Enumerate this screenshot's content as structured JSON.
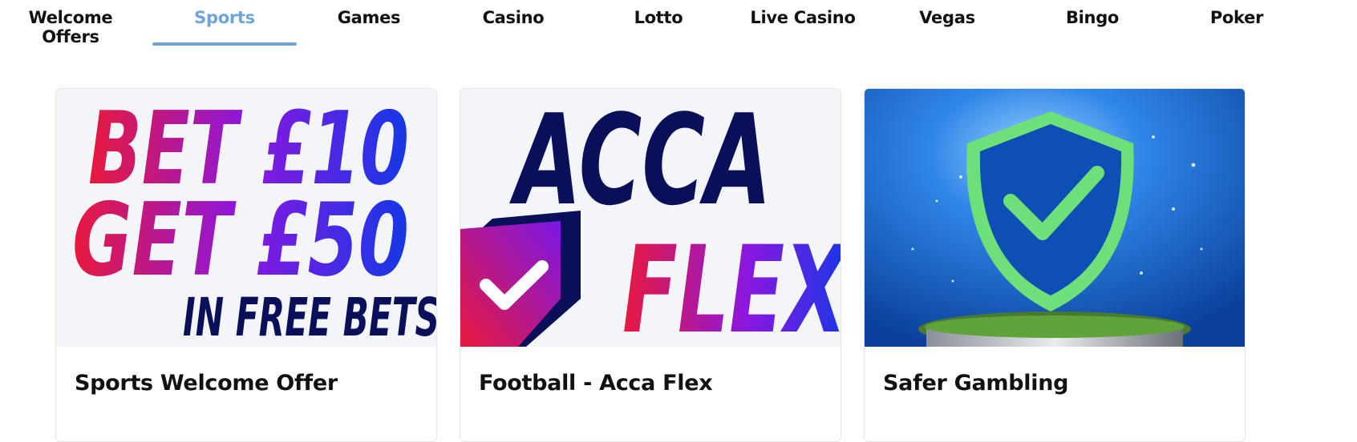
{
  "nav": {
    "tabs": [
      {
        "label": "Welcome Offers",
        "active": false
      },
      {
        "label": "Sports",
        "active": true
      },
      {
        "label": "Games",
        "active": false
      },
      {
        "label": "Casino",
        "active": false
      },
      {
        "label": "Lotto",
        "active": false
      },
      {
        "label": "Live Casino",
        "active": false
      },
      {
        "label": "Vegas",
        "active": false
      },
      {
        "label": "Bingo",
        "active": false
      },
      {
        "label": "Poker",
        "active": false
      }
    ],
    "active_color": "#6fa4d8"
  },
  "cards": [
    {
      "title": "Sports Welcome Offer",
      "image": {
        "lines": [
          "BET £10",
          "GET £50",
          "IN FREE BETS"
        ]
      }
    },
    {
      "title": "Football - Acca Flex",
      "image": {
        "lines": [
          "ACCA",
          "FLEX"
        ],
        "icon": "check-shield-icon"
      }
    },
    {
      "title": "Safer Gambling",
      "image": {
        "icon": "check-shield-icon"
      }
    }
  ],
  "colors": {
    "promo_red": "#e8193c",
    "promo_blue": "#1438e6",
    "promo_purple": "#7a17e6",
    "dark_navy": "#0a0f5a",
    "safer_blue": "#0c5fc8",
    "safer_green": "#6ee07a"
  }
}
